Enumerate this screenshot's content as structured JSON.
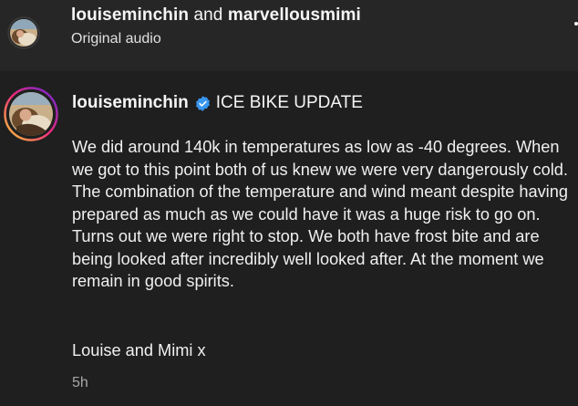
{
  "header": {
    "user_primary": "louiseminchin",
    "conjunction": "and",
    "user_secondary": "marvellousmimi",
    "subtitle": "Original audio"
  },
  "post": {
    "username": "louiseminchin",
    "verified": true,
    "headline": "ICE BIKE UPDATE",
    "body": "We did around 140k in temperatures as low as -40 degrees. When we got to this point both of us knew we were very dangerously cold. The combination of the temperature and wind meant despite having prepared as much as we could have it was a huge risk to go on. Turns out we were right to stop. We both have frost bite and are being looked after incredibly well looked after. At the moment we remain in good spirits.",
    "signoff": "Louise and Mimi x",
    "timestamp": "5h"
  },
  "colors": {
    "header_bg": "#262626",
    "post_bg": "#1f1f1f",
    "verified_blue": "#3897f0",
    "story_ring": [
      "#f9ce34",
      "#ee2a7b",
      "#6228d7"
    ]
  },
  "icons": [
    "avatar",
    "verified-badge-icon",
    "more-options-icon"
  ]
}
